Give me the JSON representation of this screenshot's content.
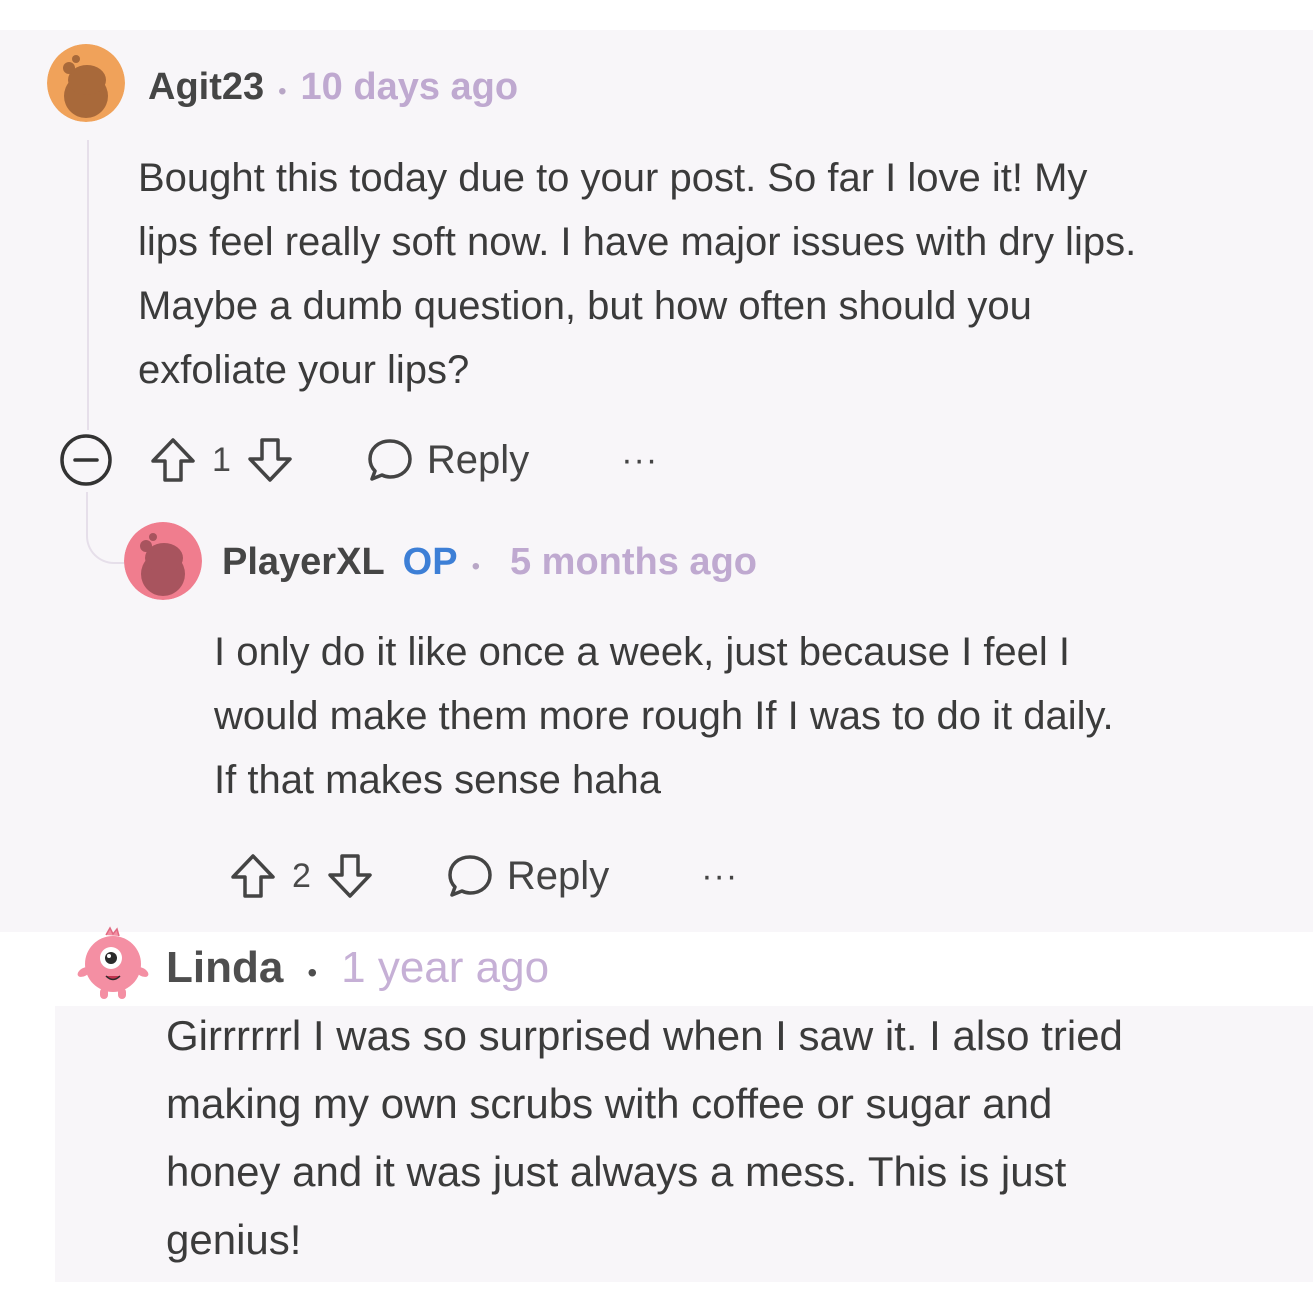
{
  "comments": [
    {
      "username": "Agit23",
      "separator": "•",
      "timestamp": "10 days ago",
      "body": [
        "Bought this today due to your post. So far I love it! My",
        "lips feel really soft now. I have major issues with dry lips.",
        "Maybe a dumb question, but how often should you",
        "exfoliate your lips?"
      ],
      "score": "1",
      "reply_label": "Reply",
      "more_label": "···",
      "avatar_color": "#f0a25a"
    },
    {
      "username": "PlayerXL",
      "op_badge": "OP",
      "separator": "•",
      "timestamp": "5 months ago",
      "body": [
        "I only do it like once a week, just because I feel I",
        "would make them more rough If I was to do it daily.",
        "If that makes sense haha"
      ],
      "score": "2",
      "reply_label": "Reply",
      "more_label": "···",
      "avatar_color": "#f07d8e"
    },
    {
      "username": "Linda",
      "separator": "•",
      "timestamp": "1 year ago",
      "body": [
        "Girrrrrrl I was so surprised when I saw it. I also tried",
        "making my own scrubs with coffee or sugar and",
        "honey and it was just always a mess. This is just",
        "genius!"
      ],
      "avatar_color": "#f48fa3"
    }
  ],
  "colors": {
    "panel_bg": "#f8f6f9",
    "timestamp": "#bfa9d0",
    "op": "#3d7fd6"
  }
}
